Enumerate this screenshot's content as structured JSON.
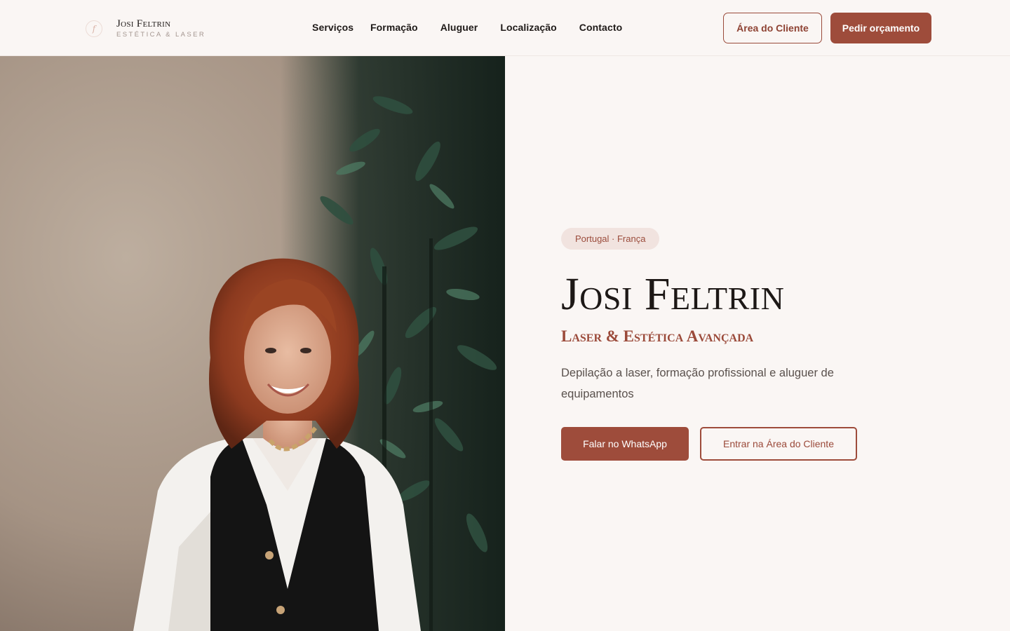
{
  "brand": {
    "name": "Josi Feltrin",
    "tagline": "Estética & Laser",
    "mark_icon": "monogram-icon"
  },
  "nav": {
    "items": [
      {
        "label": "Serviços"
      },
      {
        "label": "Formação"
      },
      {
        "label": "Aluguer"
      },
      {
        "label": "Localização"
      },
      {
        "label": "Contacto"
      }
    ]
  },
  "header_actions": {
    "client_area_label": "Área do Cliente",
    "quote_label": "Pedir orçamento"
  },
  "hero": {
    "badge": "Portugal · França",
    "title": "Josi Feltrin",
    "subtitle": "Laser & Estética Avançada",
    "description": "Depilação a laser, formação profissional e aluguer de equipamentos",
    "primary_cta": "Falar no WhatsApp",
    "secondary_cta": "Entrar na Área do Cliente"
  },
  "colors": {
    "accent": "#9e4c3b",
    "background": "#faf6f4",
    "badge_bg": "#f1e3df",
    "text_dark": "#1d1816"
  }
}
